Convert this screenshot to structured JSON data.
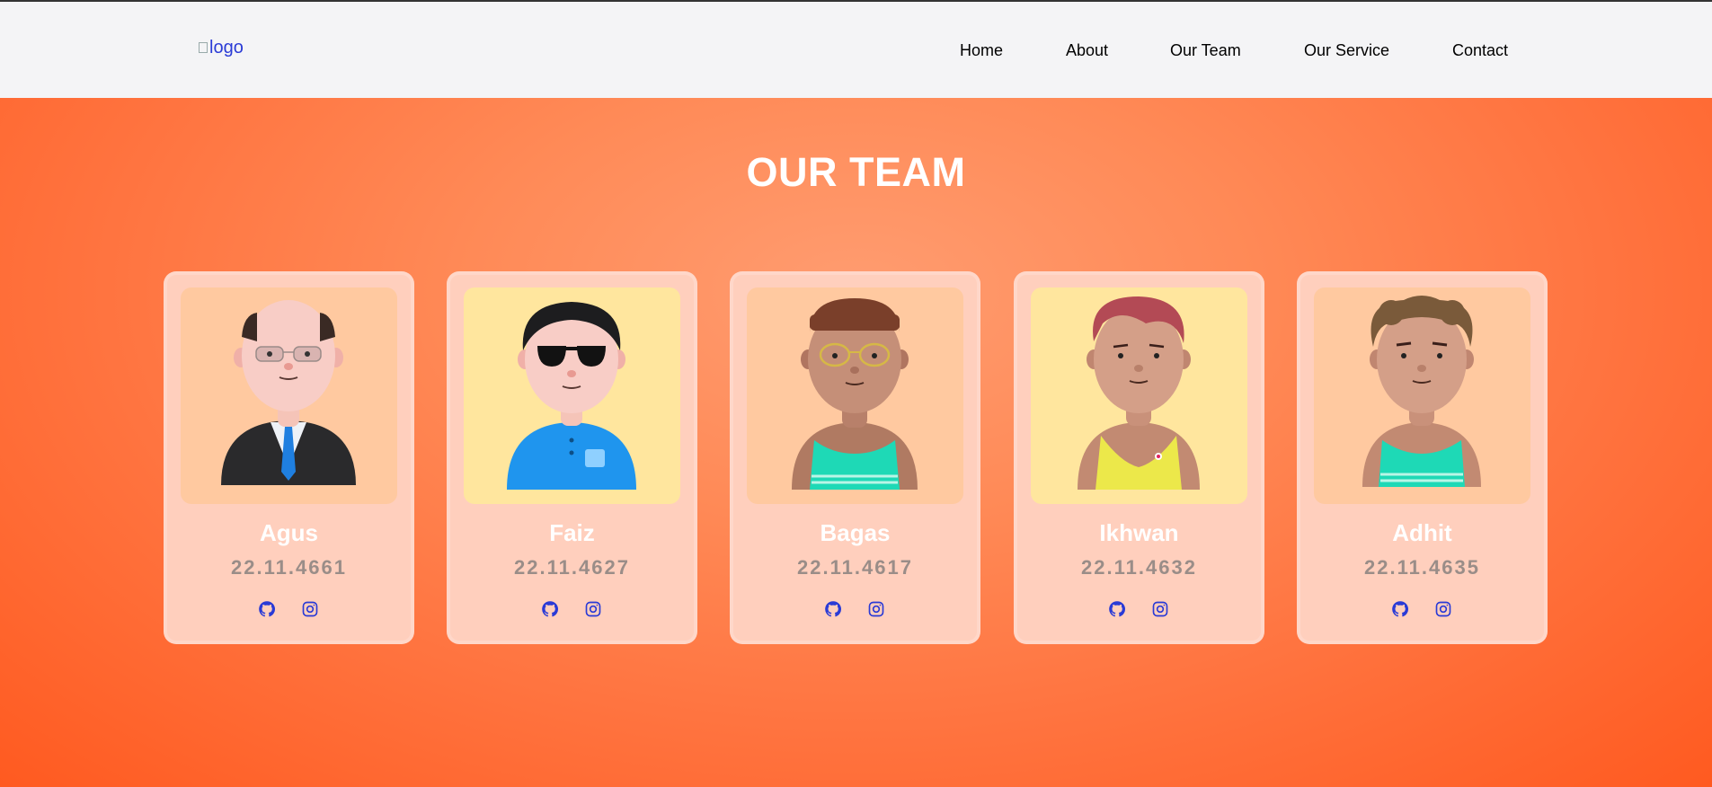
{
  "header": {
    "logo_alt": "logo",
    "nav": [
      "Home",
      "About",
      "Our Team",
      "Our Service",
      "Contact"
    ]
  },
  "team": {
    "title": "OUR TEAM",
    "members": [
      {
        "name": "Agus",
        "nim": "22.11.4661"
      },
      {
        "name": "Faiz",
        "nim": "22.11.4627"
      },
      {
        "name": "Bagas",
        "nim": "22.11.4617"
      },
      {
        "name": "Ikhwan",
        "nim": "22.11.4632"
      },
      {
        "name": "Adhit",
        "nim": "22.11.4635"
      }
    ]
  },
  "colors": {
    "accent": "#ff6a35",
    "card": "#ffcfbd",
    "icon": "#2a3bd6",
    "nim_text": "#9a8d88"
  },
  "icons": [
    "github-icon",
    "instagram-icon"
  ]
}
